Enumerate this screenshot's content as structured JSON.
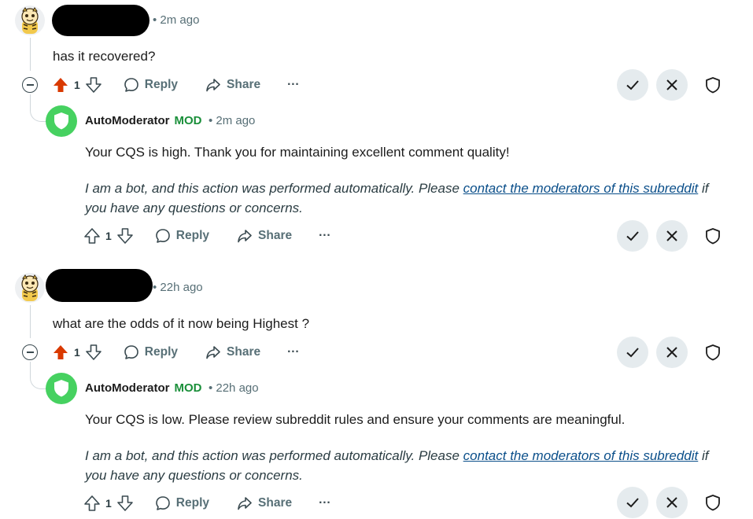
{
  "comments": [
    {
      "time": "• 2m ago",
      "text": "has it recovered?",
      "votes": "1",
      "reply_label": "Reply",
      "share_label": "Share",
      "more_label": "···",
      "reply": {
        "author": "AutoModerator",
        "badge": "MOD",
        "time": "• 2m ago",
        "text": "Your CQS is high. Thank you for maintaining excellent comment quality!",
        "note_before": "I am a bot, and this action was performed automatically. Please ",
        "note_link": "contact the moderators of this subreddit",
        "note_after": " if you have any questions or concerns.",
        "votes": "1",
        "reply_label": "Reply",
        "share_label": "Share",
        "more_label": "···"
      }
    },
    {
      "time": "• 22h ago",
      "text": "what are the odds of it now being Highest ?",
      "votes": "1",
      "reply_label": "Reply",
      "share_label": "Share",
      "more_label": "···",
      "reply": {
        "author": "AutoModerator",
        "badge": "MOD",
        "time": "• 22h ago",
        "text": "Your CQS is low. Please review subreddit rules and ensure your comments are meaningful.",
        "note_before": "I am a bot, and this action was performed automatically. Please ",
        "note_link": "contact the moderators of this subreddit",
        "note_after": " if you have any questions or concerns.",
        "votes": "1",
        "reply_label": "Reply",
        "share_label": "Share",
        "more_label": "···"
      }
    }
  ],
  "colors": {
    "upvoted": "#d93900",
    "mod_green": "#1a8f3a",
    "bot_avatar": "#46d160",
    "link": "#0b4f8a",
    "mod_button_bg": "#e5ebee"
  },
  "icons": {
    "collapse": "collapse-icon",
    "upvote": "upvote-arrow-icon",
    "downvote": "downvote-arrow-icon",
    "reply": "speech-bubble-icon",
    "share": "share-arrow-icon",
    "approve": "checkmark-icon",
    "remove": "x-icon",
    "mod_shield": "shield-icon",
    "bot_avatar": "shield-icon"
  }
}
